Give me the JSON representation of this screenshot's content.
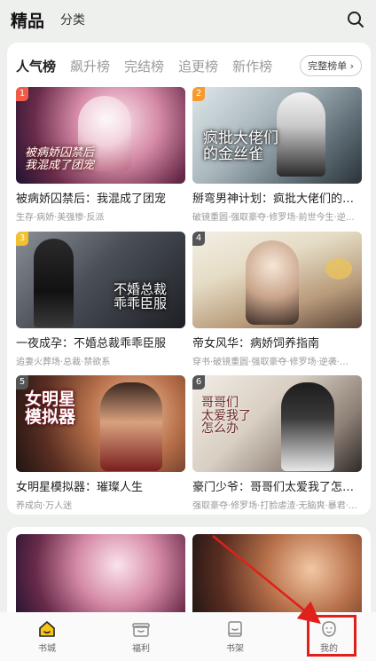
{
  "header": {
    "title": "精品",
    "tab": "分类",
    "search_icon": "search-icon"
  },
  "tabs": [
    {
      "label": "人气榜",
      "active": true
    },
    {
      "label": "飙升榜",
      "active": false
    },
    {
      "label": "完结榜",
      "active": false
    },
    {
      "label": "追更榜",
      "active": false
    },
    {
      "label": "新作榜",
      "active": false
    }
  ],
  "full_list_button": "完整榜单",
  "books": [
    {
      "rank": "1",
      "rank_color": "#f25a4a",
      "title": "被病娇囚禁后：我混成了团宠",
      "tags": "生存·病娇·美强惨·反派",
      "cover_text": "被病娇囚禁后\n我混成了团宠"
    },
    {
      "rank": "2",
      "rank_color": "#f79a2e",
      "title": "掰弯男神计划：疯批大佬们的金…",
      "tags": "破镜重圆·强取豪夺·修罗场·前世今生·逆…",
      "cover_text": "疯批大佬们\n的金丝雀"
    },
    {
      "rank": "3",
      "rank_color": "#f5c02e",
      "title": "一夜成孕：不婚总裁乖乖臣服",
      "tags": "追妻火葬场·总裁·禁欲系",
      "cover_text": "不婚总裁\n乖乖臣服"
    },
    {
      "rank": "4",
      "rank_color": "#555555",
      "title": "帝女风华：病娇饲养指南",
      "tags": "穿书·破镜重圆·强取豪夺·修罗场·逆袭·…",
      "cover_text": ""
    },
    {
      "rank": "5",
      "rank_color": "#555555",
      "title": "女明星模拟器：璀璨人生",
      "tags": "养成向·万人迷",
      "cover_text": "女明星\n模拟器"
    },
    {
      "rank": "6",
      "rank_color": "#555555",
      "title": "豪门少爷：哥哥们太爱我了怎么…",
      "tags": "强取豪夺·修罗场·打脸虐渣·无脑爽·暴君·…",
      "cover_text": "哥哥们\n太爱我了\n怎么办"
    }
  ],
  "bottom_nav": [
    {
      "label": "书城",
      "icon": "home-icon",
      "active": true
    },
    {
      "label": "福利",
      "icon": "gift-icon",
      "active": false
    },
    {
      "label": "书架",
      "icon": "bookshelf-icon",
      "active": false
    },
    {
      "label": "我的",
      "icon": "profile-icon",
      "active": false
    }
  ],
  "colors": {
    "accent": "#f5c518",
    "annotation_red": "#e0201a"
  }
}
